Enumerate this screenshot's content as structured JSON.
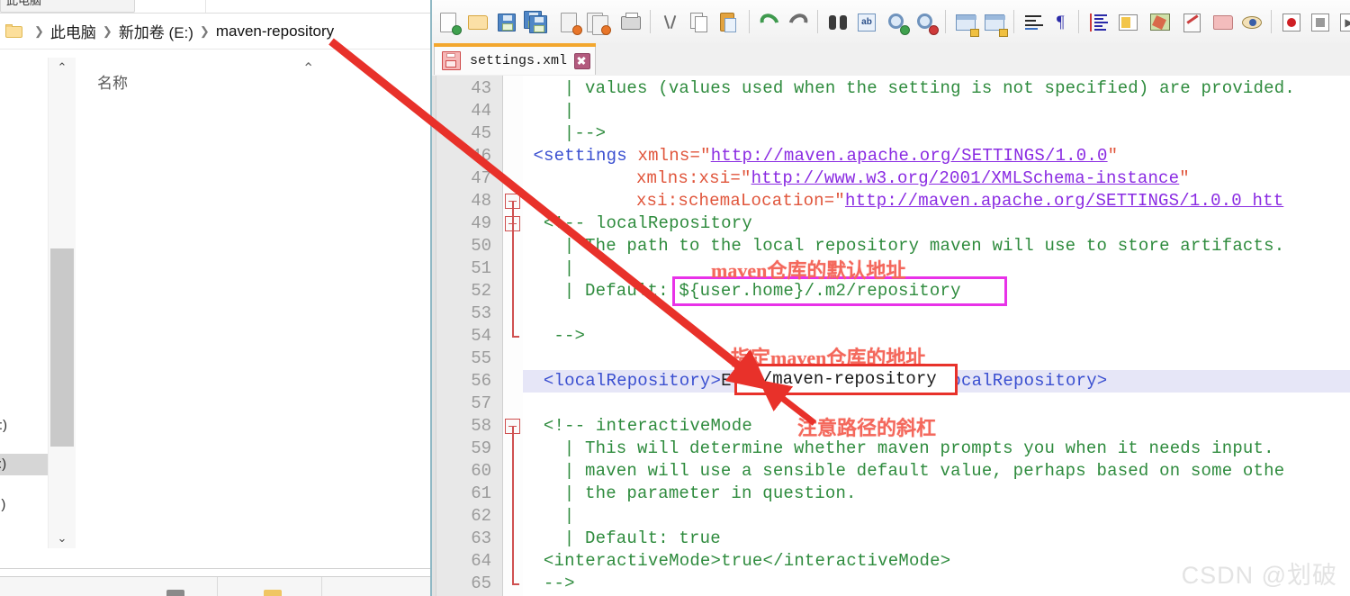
{
  "explorer": {
    "cut_tab_label": "此电脑",
    "breadcrumb": {
      "folder_icon": "folder-icon",
      "items": [
        "此电脑",
        "新加卷 (E:)",
        "maven-repository"
      ],
      "separator": "❯"
    },
    "column_header": "名称",
    "sort_caret": "⌃",
    "tree_items": [
      {
        "label": "D:)",
        "selected": false
      },
      {
        "label": "E:)",
        "selected": true
      },
      {
        "label": "F:)",
        "selected": false
      }
    ],
    "scroll_up_arrow": "⌃",
    "scroll_down_arrow": "⌄"
  },
  "notepadpp": {
    "toolbar": [
      {
        "name": "new-file-icon"
      },
      {
        "name": "open-file-icon"
      },
      {
        "name": "save-icon"
      },
      {
        "name": "save-all-icon"
      },
      {
        "name": "close-file-icon"
      },
      {
        "name": "close-all-icon"
      },
      {
        "name": "print-icon"
      },
      {
        "name": "cut-icon"
      },
      {
        "name": "copy-icon"
      },
      {
        "name": "paste-icon"
      },
      {
        "name": "undo-icon"
      },
      {
        "name": "redo-icon"
      },
      {
        "name": "find-icon"
      },
      {
        "name": "replace-icon"
      },
      {
        "name": "zoom-in-icon"
      },
      {
        "name": "zoom-out-icon"
      },
      {
        "name": "sync-vertical-icon"
      },
      {
        "name": "sync-horizontal-icon"
      },
      {
        "name": "word-wrap-icon"
      },
      {
        "name": "show-all-chars-icon"
      },
      {
        "name": "indent-guide-icon"
      },
      {
        "name": "user-defined-language-icon"
      },
      {
        "name": "document-map-icon"
      },
      {
        "name": "function-list-icon"
      },
      {
        "name": "folder-workspace-icon"
      },
      {
        "name": "monitor-icon"
      },
      {
        "name": "macro-record-icon"
      },
      {
        "name": "macro-stop-icon"
      },
      {
        "name": "macro-play-icon"
      }
    ],
    "tab": {
      "label": "settings.xml",
      "save_state_icon": "unsaved-save-icon",
      "close_icon": "close-icon"
    },
    "editor": {
      "first_line_number": 43,
      "current_line": 56,
      "lines": [
        {
          "n": 43,
          "indent": 4,
          "segs": [
            {
              "t": "| values (values used when the setting is not specified) are provided.",
              "c": "c-com"
            }
          ]
        },
        {
          "n": 44,
          "indent": 4,
          "segs": [
            {
              "t": "|",
              "c": "c-com"
            }
          ]
        },
        {
          "n": 45,
          "indent": 4,
          "segs": [
            {
              "t": "|-->",
              "c": "c-com"
            }
          ]
        },
        {
          "n": 46,
          "indent": 1,
          "segs": [
            {
              "t": "<settings ",
              "c": "c-tag"
            },
            {
              "t": "xmlns",
              "c": "c-attr"
            },
            {
              "t": "=",
              "c": "c-attr"
            },
            {
              "t": "\"",
              "c": "c-attr"
            },
            {
              "t": "http://maven.apache.org/SETTINGS/1.0.0",
              "c": "c-val"
            },
            {
              "t": "\"",
              "c": "c-attr"
            }
          ]
        },
        {
          "n": 47,
          "indent": 11,
          "segs": [
            {
              "t": "xmlns:xsi",
              "c": "c-attr"
            },
            {
              "t": "=\"",
              "c": "c-attr"
            },
            {
              "t": "http://www.w3.org/2001/XMLSchema-instance",
              "c": "c-val"
            },
            {
              "t": "\"",
              "c": "c-attr"
            }
          ]
        },
        {
          "n": 48,
          "indent": 11,
          "segs": [
            {
              "t": "xsi:schemaLocation",
              "c": "c-attr"
            },
            {
              "t": "=\"",
              "c": "c-attr"
            },
            {
              "t": "http://maven.apache.org/SETTINGS/1.0.0 ",
              "c": "c-val"
            },
            {
              "t": "htt",
              "c": "c-val"
            }
          ]
        },
        {
          "n": 49,
          "indent": 2,
          "segs": [
            {
              "t": "<!-- localRepository",
              "c": "c-com"
            }
          ]
        },
        {
          "n": 50,
          "indent": 4,
          "segs": [
            {
              "t": "| The path to the local repository maven will use to store artifacts.",
              "c": "c-com"
            }
          ]
        },
        {
          "n": 51,
          "indent": 4,
          "segs": [
            {
              "t": "|",
              "c": "c-com"
            }
          ]
        },
        {
          "n": 52,
          "indent": 4,
          "segs": [
            {
              "t": "| Default: ${user.home}/.m2/repository",
              "c": "c-com"
            }
          ]
        },
        {
          "n": 53,
          "indent": 4,
          "segs": []
        },
        {
          "n": 54,
          "indent": 3,
          "segs": [
            {
              "t": "-->",
              "c": "c-com"
            }
          ]
        },
        {
          "n": 55,
          "indent": 3,
          "segs": []
        },
        {
          "n": 56,
          "indent": 2,
          "segs": [
            {
              "t": "<localRepository>",
              "c": "c-tag"
            },
            {
              "t": "E:/maven-repository",
              "c": "c-txt"
            },
            {
              "t": "</localRepository>",
              "c": "c-tag"
            }
          ]
        },
        {
          "n": 57,
          "indent": 2,
          "segs": []
        },
        {
          "n": 58,
          "indent": 2,
          "segs": [
            {
              "t": "<!-- interactiveMode",
              "c": "c-com"
            }
          ]
        },
        {
          "n": 59,
          "indent": 4,
          "segs": [
            {
              "t": "| This will determine whether maven prompts you when it needs input.",
              "c": "c-com"
            }
          ]
        },
        {
          "n": 60,
          "indent": 4,
          "segs": [
            {
              "t": "| maven will use a sensible default value, perhaps based on some othe",
              "c": "c-com"
            }
          ]
        },
        {
          "n": 61,
          "indent": 4,
          "segs": [
            {
              "t": "| the parameter in question.",
              "c": "c-com"
            }
          ]
        },
        {
          "n": 62,
          "indent": 4,
          "segs": [
            {
              "t": "|",
              "c": "c-com"
            }
          ]
        },
        {
          "n": 63,
          "indent": 4,
          "segs": [
            {
              "t": "| Default: true",
              "c": "c-com"
            }
          ]
        },
        {
          "n": 64,
          "indent": 2,
          "segs": [
            {
              "t": "<interactiveMode>true</interactiveMode>",
              "c": "c-com"
            }
          ]
        },
        {
          "n": 65,
          "indent": 2,
          "segs": [
            {
              "t": "-->",
              "c": "c-com"
            }
          ]
        }
      ],
      "fold_boxes": [
        48,
        49,
        58
      ],
      "fold_ticks": [
        54,
        65
      ]
    }
  },
  "annotations": {
    "note_default_repo": "maven仓库的默认地址",
    "note_specify_repo": "指定maven仓库的地址",
    "note_slash": "注意路径的斜杠",
    "boxed_default_value": "${user.home}/.m2/repository",
    "boxed_repo_path": "E:/maven-repository",
    "colors": {
      "magenta_box": "#e832e8",
      "red_box": "#e8312a",
      "arrow_red": "#e8312a",
      "note_text": "#f4685c"
    }
  },
  "watermark": "CSDN @划破"
}
